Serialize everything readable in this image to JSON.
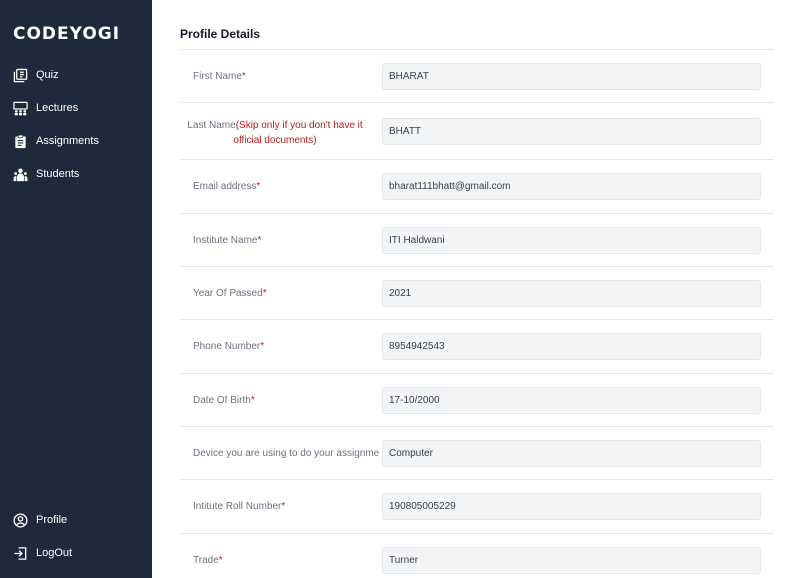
{
  "brand": "CODEYOGI",
  "sidebar": {
    "items": [
      {
        "label": "Quiz",
        "icon": "quiz-icon"
      },
      {
        "label": "Lectures",
        "icon": "lectures-icon"
      },
      {
        "label": "Assignments",
        "icon": "assignments-icon"
      },
      {
        "label": "Students",
        "icon": "students-icon"
      }
    ],
    "bottom": [
      {
        "label": "Profile",
        "icon": "profile-icon"
      },
      {
        "label": "LogOut",
        "icon": "logout-icon"
      }
    ]
  },
  "main": {
    "title": "Profile Details",
    "fields": [
      {
        "label": "First Name",
        "required": "*",
        "value": "BHARAT"
      },
      {
        "label": "Last Name",
        "note": "(Skip only if you don't have it official documents)",
        "value": "BHATT"
      },
      {
        "label": "Email address",
        "required": "*",
        "value": "bharat111bhatt@gmail.com"
      },
      {
        "label": "Institute Name",
        "required": "*",
        "value": "ITI Haldwani"
      },
      {
        "label": "Year Of Passed",
        "required": "*",
        "value": "2021"
      },
      {
        "label": "Phone Number",
        "required": "*",
        "value": "8954942543"
      },
      {
        "label": "Date Of Birth",
        "required": "*",
        "value": "17-10/2000"
      },
      {
        "label": "Device you are using to do your assignme",
        "value": "Computer"
      },
      {
        "label": "Intitute Roll Number",
        "required": "*",
        "value": "190805005229"
      },
      {
        "label": "Trade",
        "required": "*",
        "value": "Turner"
      }
    ]
  }
}
